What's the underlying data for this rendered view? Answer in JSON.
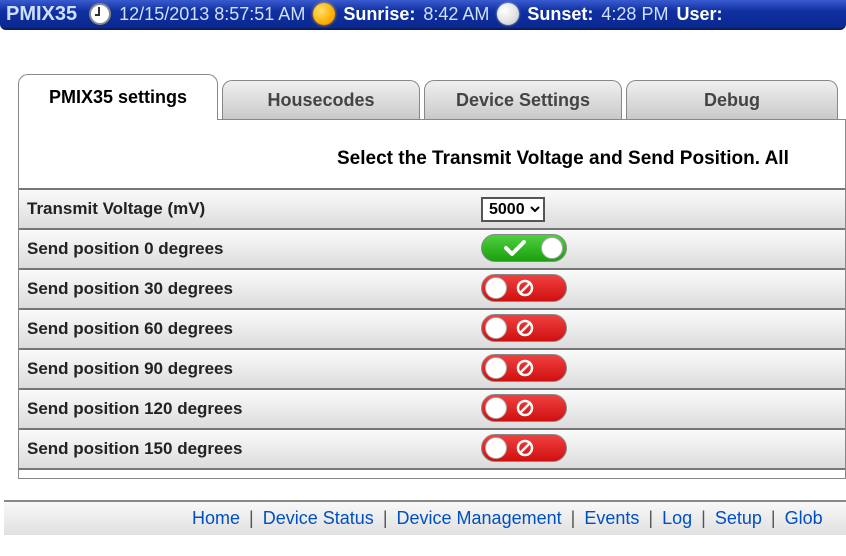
{
  "header": {
    "app_title": "PMIX35",
    "datetime": "12/15/2013 8:57:51 AM",
    "sunrise_label": "Sunrise:",
    "sunrise_value": "8:42 AM",
    "sunset_label": "Sunset:",
    "sunset_value": "4:28 PM",
    "user_label": "User:"
  },
  "tabs": {
    "items": [
      {
        "label": "PMIX35 settings",
        "active": true
      },
      {
        "label": "Housecodes",
        "active": false
      },
      {
        "label": "Device Settings",
        "active": false
      },
      {
        "label": "Debug",
        "active": false
      }
    ],
    "instruction": "Select the Transmit Voltage and Send Position. All"
  },
  "settings": {
    "voltage": {
      "label": "Transmit Voltage (mV)",
      "selected": "5000",
      "options": [
        "5000"
      ]
    },
    "positions": [
      {
        "label": "Send position 0 degrees",
        "on": true
      },
      {
        "label": "Send position 30 degrees",
        "on": false
      },
      {
        "label": "Send position 60 degrees",
        "on": false
      },
      {
        "label": "Send position 90 degrees",
        "on": false
      },
      {
        "label": "Send position 120 degrees",
        "on": false
      },
      {
        "label": "Send position 150 degrees",
        "on": false
      }
    ]
  },
  "footer": {
    "links": [
      "Home",
      "Device Status",
      "Device Management",
      "Events",
      "Log",
      "Setup",
      "Glob"
    ]
  }
}
